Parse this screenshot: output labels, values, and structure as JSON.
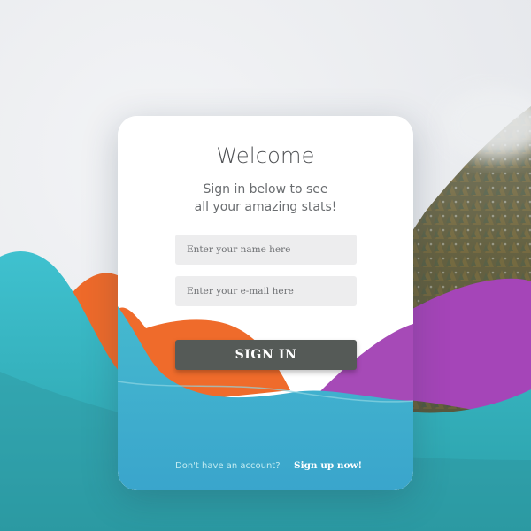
{
  "card": {
    "title": "Welcome",
    "subtitle_line1": "Sign in below to see",
    "subtitle_line2": "all your amazing stats!"
  },
  "form": {
    "name_placeholder": "Enter your name here",
    "email_placeholder": "Enter your e-mail here",
    "submit_label": "SIGN IN"
  },
  "footer": {
    "prompt": "Don't have an account?",
    "signup_link": "Sign up now!"
  },
  "colors": {
    "background": "#eceef1",
    "card": "#ffffff",
    "teal_wave": "#3fbccd",
    "orange_wave": "#ee6a2a",
    "purple_wave": "#a545b8",
    "button": "#555a57",
    "input": "#ededee"
  }
}
